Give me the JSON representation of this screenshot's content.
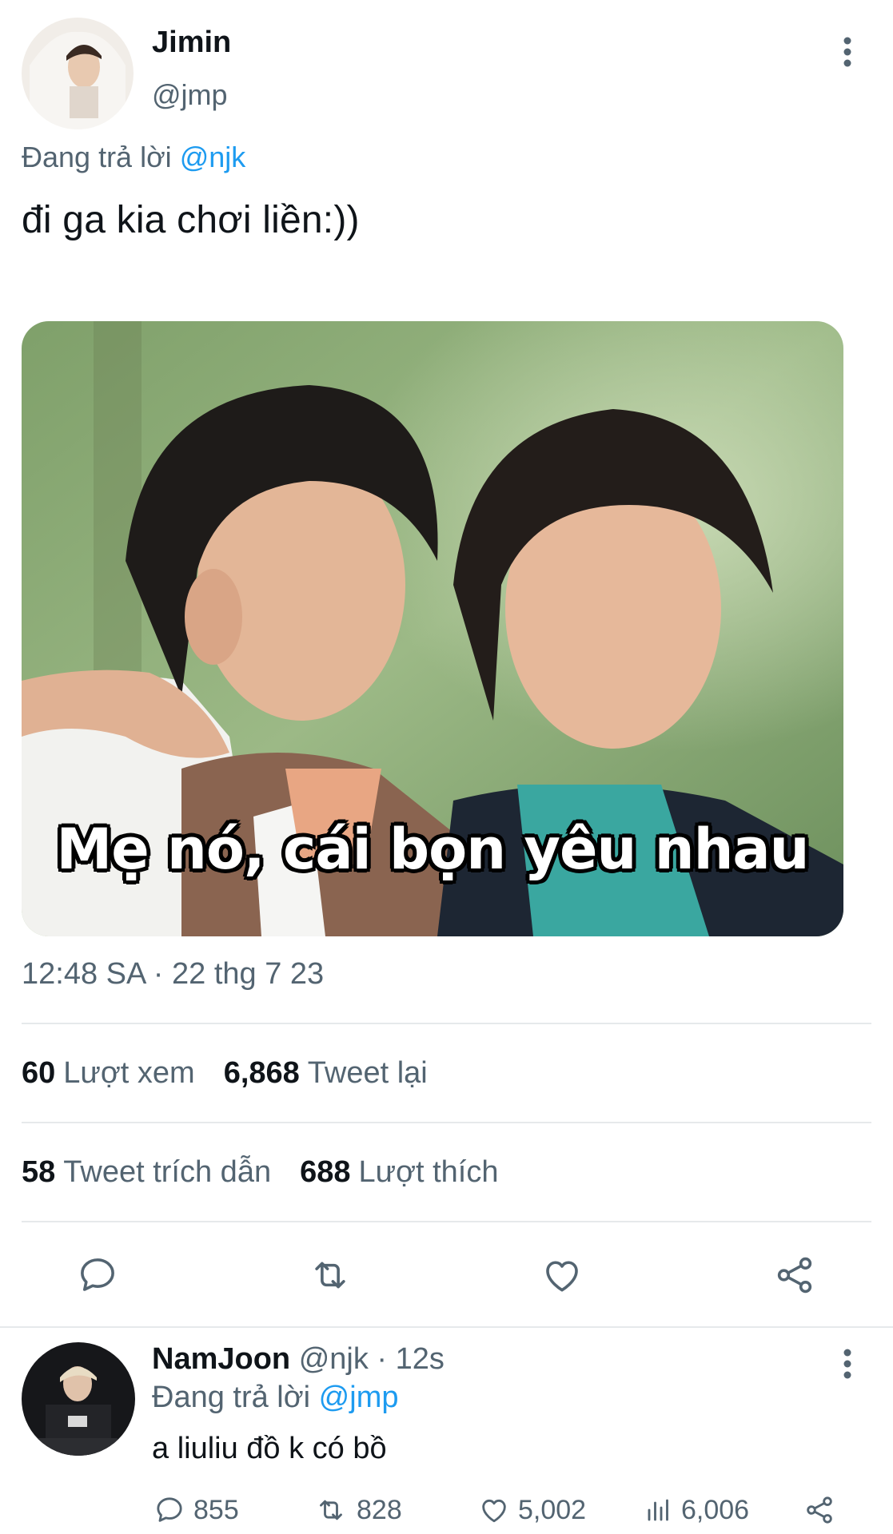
{
  "main_tweet": {
    "author_name": "Jimin",
    "author_handle": "@jmp",
    "replying_prefix": "Đang trả lời",
    "replying_to": "@njk",
    "text": "đi ga kia chơi liền:))",
    "media_caption": "Mẹ nó, cái bọn yêu nhau",
    "timestamp": "12:48 SA · 22 thg 7 23",
    "stats": {
      "views_count": "60",
      "views_label": "Lượt xem",
      "retweets_count": "6,868",
      "retweets_label": "Tweet lại",
      "quotes_count": "58",
      "quotes_label": "Tweet trích dẫn",
      "likes_count": "688",
      "likes_label": "Lượt thích"
    },
    "actions": [
      "reply-icon",
      "retweet-icon",
      "like-icon",
      "share-icon"
    ]
  },
  "reply_tweet": {
    "author_name": "NamJoon",
    "author_handle": "@njk",
    "time": "· 12s",
    "replying_prefix": "Đang trả lời",
    "replying_to": "@jmp",
    "text": "a liuliu đồ k có bồ",
    "counts": {
      "replies": "855",
      "retweets": "828",
      "likes": "5,002",
      "views": "6,006"
    }
  },
  "colors": {
    "text_primary": "#0f1419",
    "text_secondary": "#536471",
    "accent": "#1d9bf0",
    "divider": "#e6e9eb"
  }
}
